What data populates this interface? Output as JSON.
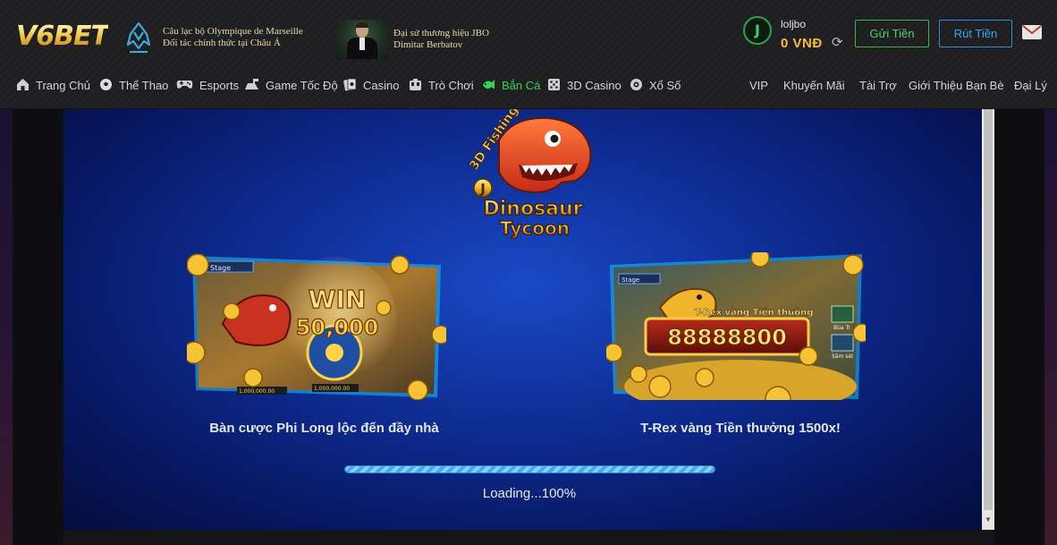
{
  "header": {
    "logo_text": "V6BET",
    "partner_line1": "Câu lạc bộ Olympique de Marseille",
    "partner_line2": "Đối tác chính thức tại Châu Á",
    "ambassador_line1": "Đại sứ thương hiệu JBO",
    "ambassador_line2": "Dimitar Berbatov",
    "username": "loljbo",
    "balance": "0  VNĐ",
    "deposit_label": "Gửi Tiền",
    "withdraw_label": "Rút Tiền"
  },
  "nav": {
    "items": [
      {
        "label": "Trang Chủ",
        "icon": "home-icon"
      },
      {
        "label": "Thể Thao",
        "icon": "soccer-ball-icon"
      },
      {
        "label": "Esports",
        "icon": "gamepad-icon"
      },
      {
        "label": "Game Tốc Độ",
        "icon": "racing-icon"
      },
      {
        "label": "Casino",
        "icon": "cards-icon"
      },
      {
        "label": "Trò Chơi",
        "icon": "slot-machine-icon"
      },
      {
        "label": "Bắn Cá",
        "icon": "fish-icon",
        "active": true
      },
      {
        "label": "3D Casino",
        "icon": "dice-icon"
      },
      {
        "label": "Xổ Số",
        "icon": "lottery-ball-icon"
      }
    ],
    "right_items": [
      "VIP",
      "Khuyến Mãi",
      "Tài Trợ",
      "Giới Thiệu Bạn Bè",
      "Đại Lý"
    ]
  },
  "game": {
    "logo_small": "3D Fishing",
    "logo_j": "J",
    "logo_title1": "Dinosaur",
    "logo_title2": "Tycoon",
    "panel_left": {
      "stage_label": "Stage",
      "win_text": "WIN",
      "win_amount": "50,000",
      "chips": "1,000,000.00",
      "chips2": "1,000,000.00",
      "caption": "Bàn cược Phi Long lộc đến đầy nhà"
    },
    "panel_right": {
      "stage_label": "Stage",
      "bonus_title": "T-Rex vàng Tiền thưởng",
      "bonus_amount": "88888800",
      "side_label1": "Bùa Tr",
      "side_label2": "Săm sét",
      "caption": "T-Rex vàng Tiền thưởng 1500x!"
    },
    "loading_progress": 100,
    "loading_text": "Loading...100%"
  },
  "colors": {
    "accent_green": "#33d35a",
    "deposit_green": "#3bb54a",
    "withdraw_blue": "#2d8fd6",
    "balance_gold": "#f2c230",
    "game_bg_blue": "#0d2a8e"
  }
}
